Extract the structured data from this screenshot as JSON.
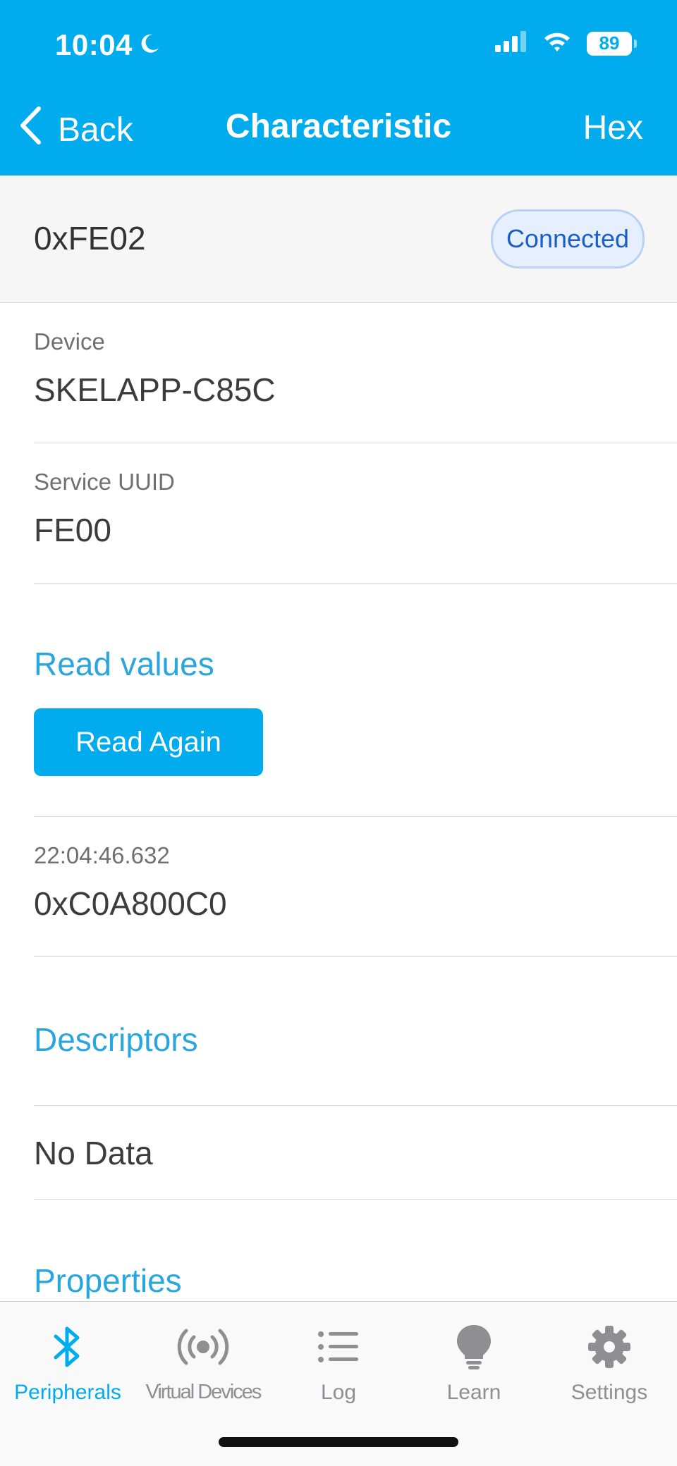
{
  "status_bar": {
    "time": "10:04",
    "battery": "89"
  },
  "nav": {
    "back_label": "Back",
    "title": "Characteristic",
    "right_label": "Hex"
  },
  "characteristic": {
    "uuid": "0xFE02",
    "status": "Connected"
  },
  "device": {
    "label": "Device",
    "value": "SKELAPP-C85C"
  },
  "service": {
    "label": "Service UUID",
    "value": "FE00"
  },
  "read_values": {
    "title": "Read values",
    "button_label": "Read Again",
    "entries": [
      {
        "timestamp": "22:04:46.632",
        "value": "0xC0A800C0"
      }
    ]
  },
  "descriptors": {
    "title": "Descriptors",
    "empty_text": "No Data"
  },
  "properties": {
    "title": "Properties"
  },
  "tab_bar": {
    "tabs": [
      {
        "label": "Peripherals",
        "icon": "bluetooth-icon",
        "active": true
      },
      {
        "label": "Virtual Devices",
        "icon": "broadcast-icon",
        "active": false
      },
      {
        "label": "Log",
        "icon": "list-icon",
        "active": false
      },
      {
        "label": "Learn",
        "icon": "lightbulb-icon",
        "active": false
      },
      {
        "label": "Settings",
        "icon": "gear-icon",
        "active": false
      }
    ]
  },
  "colors": {
    "accent": "#00acee",
    "section_title": "#2aa6df",
    "badge_text": "#1c5fc4"
  }
}
